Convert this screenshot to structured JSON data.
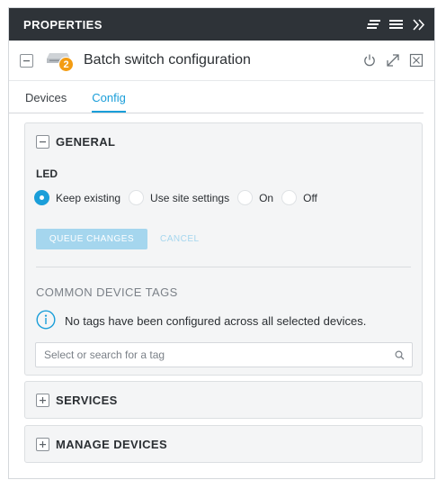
{
  "header": {
    "title": "PROPERTIES"
  },
  "device": {
    "count": "2",
    "title": "Batch switch configuration"
  },
  "tabs": [
    {
      "label": "Devices"
    },
    {
      "label": "Config"
    }
  ],
  "general": {
    "title": "GENERAL",
    "led_label": "LED",
    "options": [
      {
        "label": "Keep existing",
        "checked": true
      },
      {
        "label": "Use site settings",
        "checked": false
      },
      {
        "label": "On",
        "checked": false
      },
      {
        "label": "Off",
        "checked": false
      }
    ],
    "queue_button": "QUEUE CHANGES",
    "cancel_button": "CANCEL",
    "tags_title": "COMMON DEVICE TAGS",
    "tags_info": "No tags have been configured across all selected devices.",
    "tag_placeholder": "Select or search for a tag"
  },
  "services": {
    "title": "SERVICES"
  },
  "manage": {
    "title": "MANAGE DEVICES"
  },
  "colors": {
    "accent": "#1a9ed9",
    "header_bg": "#2e3338",
    "badge": "#f39c12",
    "disabled_button": "#a5d6ee"
  }
}
